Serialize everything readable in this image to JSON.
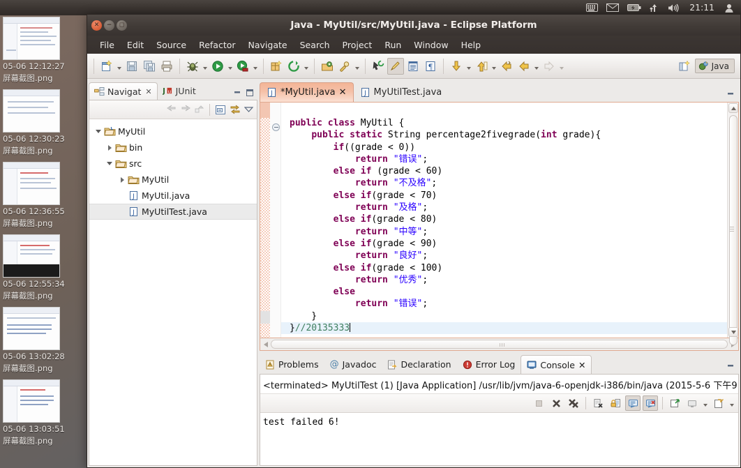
{
  "desktop": {
    "files": [
      {
        "label_line1": "05-06 12:12:27",
        "label_line2": "屏幕截图.png"
      },
      {
        "label_line1": "05-06 12:30:23",
        "label_line2": "屏幕截图.png"
      },
      {
        "label_line1": "05-06 12:36:55",
        "label_line2": "屏幕截图.png"
      },
      {
        "label_line1": "05-06 12:55:34",
        "label_line2": "屏幕截图.png"
      },
      {
        "label_line1": "05-06 13:02:28",
        "label_line2": "屏幕截图.png"
      },
      {
        "label_line1": "05-06 13:03:51",
        "label_line2": "屏幕截图.png"
      }
    ]
  },
  "top_panel": {
    "clock": "21:11",
    "indicators": [
      "keyboard-icon",
      "mail-icon",
      "battery-icon",
      "network-icon",
      "volume-icon",
      "user-icon"
    ]
  },
  "window": {
    "title": "Java - MyUtil/src/MyUtil.java - Eclipse Platform",
    "controls": {
      "close": "close-icon",
      "minimize": "minimize-icon",
      "maximize": "maximize-icon"
    }
  },
  "menubar": {
    "items": [
      "File",
      "Edit",
      "Source",
      "Refactor",
      "Navigate",
      "Search",
      "Project",
      "Run",
      "Window",
      "Help"
    ]
  },
  "toolbar": {
    "perspective_label": "Java",
    "buttons": [
      "new-icon",
      "save-icon",
      "save-all-icon",
      "print-icon",
      "debug-icon",
      "run-icon",
      "coverage-icon",
      "new-java-package-icon",
      "external-tools-icon",
      "open-type-icon",
      "search-icon",
      "last-edit-location-icon",
      "toggle-mark-occurrences-icon",
      "show-whitespace-icon",
      "pilcrow-icon",
      "next-annotation-icon",
      "previous-annotation-icon",
      "back-icon",
      "forward-icon",
      "forward-dim-icon"
    ]
  },
  "left_view": {
    "tabs": [
      {
        "label": "Navigat",
        "icon": "navigator-icon",
        "active": true,
        "closable": true
      },
      {
        "label": "JUnit",
        "icon": "junit-icon",
        "active": false,
        "closable": false
      }
    ],
    "toolbar_icons": [
      "back-icon",
      "forward-icon",
      "up-icon",
      "collapse-all-icon",
      "link-with-editor-icon",
      "view-menu-icon"
    ],
    "panel_buttons": [
      "minimize-icon",
      "maximize-icon"
    ],
    "tree": [
      {
        "label": "MyUtil",
        "indent": 0,
        "arrow": "down",
        "icon": "project-icon",
        "selected": false
      },
      {
        "label": "bin",
        "indent": 1,
        "arrow": "right",
        "icon": "folder-icon",
        "selected": false
      },
      {
        "label": "src",
        "indent": 1,
        "arrow": "down",
        "icon": "folder-icon",
        "selected": false
      },
      {
        "label": "MyUtil",
        "indent": 2,
        "arrow": "right",
        "icon": "folder-icon",
        "selected": false
      },
      {
        "label": "MyUtil.java",
        "indent": 2,
        "arrow": "none",
        "icon": "java-file-icon",
        "selected": false
      },
      {
        "label": "MyUtilTest.java",
        "indent": 2,
        "arrow": "none",
        "icon": "java-file-icon",
        "selected": true
      }
    ]
  },
  "editor": {
    "tabs": [
      {
        "label": "*MyUtil.java",
        "icon": "java-file-icon",
        "active": true,
        "closable": true
      },
      {
        "label": "MyUtilTest.java",
        "icon": "java-file-icon",
        "active": false,
        "closable": false
      }
    ],
    "panel_buttons": [
      "minimize-icon"
    ],
    "code_lines": [
      [
        {
          "t": "public ",
          "c": "kw"
        },
        {
          "t": "class ",
          "c": "kw"
        },
        {
          "t": "MyUtil {",
          "c": ""
        }
      ],
      [
        {
          "t": "    ",
          "c": ""
        },
        {
          "t": "public static ",
          "c": "kw"
        },
        {
          "t": "String percentage2fivegrade(",
          "c": ""
        },
        {
          "t": "int",
          "c": "kw"
        },
        {
          "t": " grade){",
          "c": ""
        }
      ],
      [
        {
          "t": "        ",
          "c": ""
        },
        {
          "t": "if",
          "c": "kw"
        },
        {
          "t": "((grade < 0))",
          "c": ""
        }
      ],
      [
        {
          "t": "            ",
          "c": ""
        },
        {
          "t": "return ",
          "c": "kw"
        },
        {
          "t": "\"错误\"",
          "c": "str"
        },
        {
          "t": ";",
          "c": ""
        }
      ],
      [
        {
          "t": "        ",
          "c": ""
        },
        {
          "t": "else if ",
          "c": "kw"
        },
        {
          "t": "(grade < 60)",
          "c": ""
        }
      ],
      [
        {
          "t": "            ",
          "c": ""
        },
        {
          "t": "return ",
          "c": "kw"
        },
        {
          "t": "\"不及格\"",
          "c": "str"
        },
        {
          "t": ";",
          "c": ""
        }
      ],
      [
        {
          "t": "        ",
          "c": ""
        },
        {
          "t": "else if",
          "c": "kw"
        },
        {
          "t": "(grade < 70)",
          "c": ""
        }
      ],
      [
        {
          "t": "            ",
          "c": ""
        },
        {
          "t": "return ",
          "c": "kw"
        },
        {
          "t": "\"及格\"",
          "c": "str"
        },
        {
          "t": ";",
          "c": ""
        }
      ],
      [
        {
          "t": "        ",
          "c": ""
        },
        {
          "t": "else if",
          "c": "kw"
        },
        {
          "t": "(grade < 80)",
          "c": ""
        }
      ],
      [
        {
          "t": "            ",
          "c": ""
        },
        {
          "t": "return ",
          "c": "kw"
        },
        {
          "t": "\"中等\"",
          "c": "str"
        },
        {
          "t": ";",
          "c": ""
        }
      ],
      [
        {
          "t": "        ",
          "c": ""
        },
        {
          "t": "else if",
          "c": "kw"
        },
        {
          "t": "(grade < 90)",
          "c": ""
        }
      ],
      [
        {
          "t": "            ",
          "c": ""
        },
        {
          "t": "return ",
          "c": "kw"
        },
        {
          "t": "\"良好\"",
          "c": "str"
        },
        {
          "t": ";",
          "c": ""
        }
      ],
      [
        {
          "t": "        ",
          "c": ""
        },
        {
          "t": "else if",
          "c": "kw"
        },
        {
          "t": "(grade < 100)",
          "c": ""
        }
      ],
      [
        {
          "t": "            ",
          "c": ""
        },
        {
          "t": "return ",
          "c": "kw"
        },
        {
          "t": "\"优秀\"",
          "c": "str"
        },
        {
          "t": ";",
          "c": ""
        }
      ],
      [
        {
          "t": "        ",
          "c": ""
        },
        {
          "t": "else",
          "c": "kw"
        }
      ],
      [
        {
          "t": "            ",
          "c": ""
        },
        {
          "t": "return ",
          "c": "kw"
        },
        {
          "t": "\"错误\"",
          "c": "str"
        },
        {
          "t": ";",
          "c": ""
        }
      ],
      [
        {
          "t": "    }",
          "c": ""
        }
      ],
      [
        {
          "t": "}",
          "c": ""
        },
        {
          "t": "//20135333",
          "c": "cmt"
        }
      ]
    ],
    "current_line_index": 17
  },
  "console": {
    "tabs": [
      {
        "label": "Problems",
        "icon": "problems-icon",
        "active": false,
        "closable": false
      },
      {
        "label": "Javadoc",
        "icon": "javadoc-icon",
        "active": false,
        "closable": false
      },
      {
        "label": "Declaration",
        "icon": "declaration-icon",
        "active": false,
        "closable": false
      },
      {
        "label": "Error Log",
        "icon": "error-log-icon",
        "active": false,
        "closable": false
      },
      {
        "label": "Console",
        "icon": "console-icon",
        "active": true,
        "closable": true
      }
    ],
    "panel_buttons": [
      "minimize-icon"
    ],
    "launch_title": "<terminated> MyUtilTest (1) [Java Application] /usr/lib/jvm/java-6-openjdk-i386/bin/java (2015-5-6 下午9",
    "toolbar_icons": [
      "terminate-icon",
      "remove-launch-icon",
      "remove-all-launches-icon",
      "clear-console-icon",
      "scroll-lock-icon",
      "show-console-icon",
      "show-console-on-error-icon",
      "pin-console-icon",
      "display-selected-console-icon",
      "open-console-icon"
    ],
    "output": "test failed 6!"
  },
  "colors": {
    "editor_tab_active": "#f3b496",
    "keyword": "#7f0055",
    "string": "#2a00ff",
    "comment": "#3f7f5f",
    "selection": "#e8f2fb",
    "titlebar": "#413b37"
  }
}
